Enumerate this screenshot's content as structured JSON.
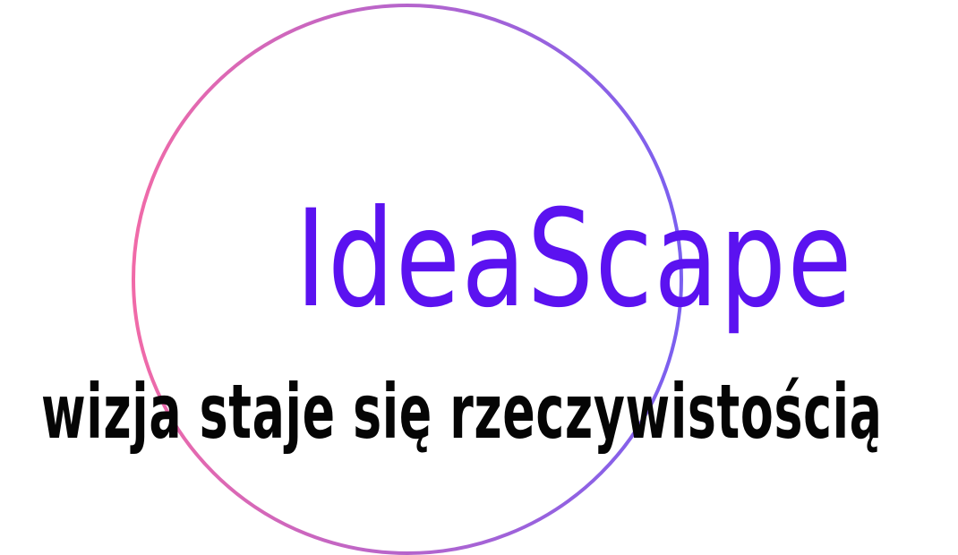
{
  "logo": {
    "brand_name": "IdeaScape",
    "tagline": "wizja staje się rzeczywistością",
    "colors": {
      "brand_text": "#5b12f0",
      "tagline_text": "#050505",
      "ring_gradient_start": "#f06aa8",
      "ring_gradient_end": "#7a5ff0",
      "background": "#ffffff"
    },
    "icon": "gradient-circle-ring"
  }
}
